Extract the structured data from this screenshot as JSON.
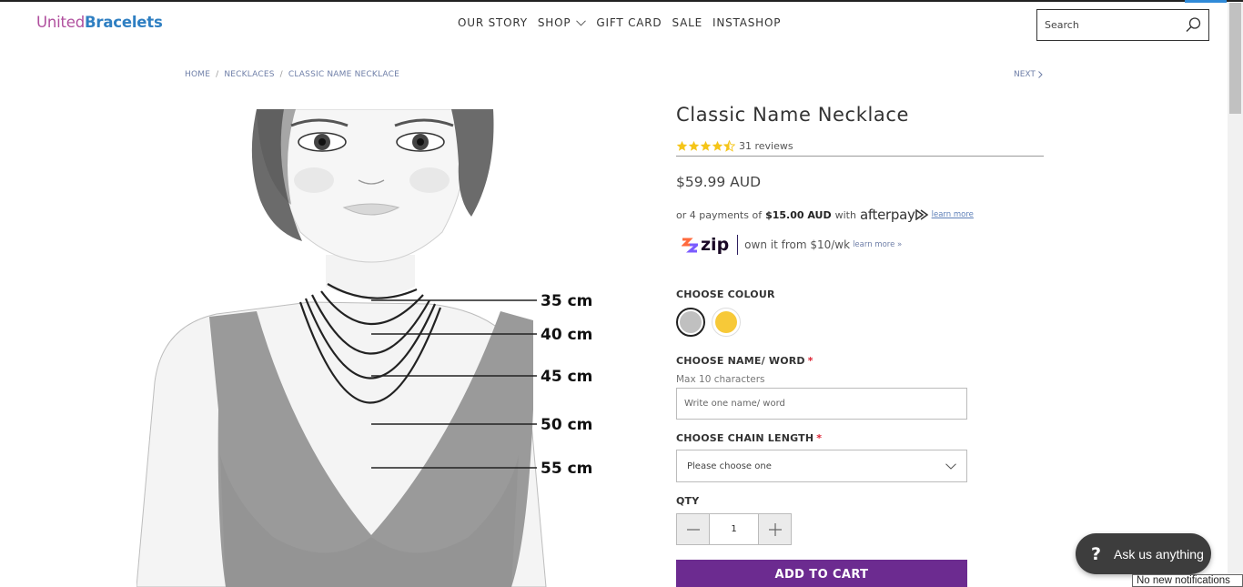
{
  "logo": {
    "part1": "United",
    "part2": "Bracelets"
  },
  "nav": {
    "items": [
      {
        "label": "OUR STORY"
      },
      {
        "label": "SHOP"
      },
      {
        "label": "GIFT CARD"
      },
      {
        "label": "SALE"
      },
      {
        "label": "INSTASHOP"
      }
    ]
  },
  "search": {
    "placeholder": "Search",
    "icon": "search-icon"
  },
  "breadcrumb": {
    "items": [
      "HOME",
      "NECKLACES",
      "CLASSIC NAME NECKLACE"
    ],
    "separator": "/",
    "next": "NEXT"
  },
  "product_image": {
    "chain_lengths": [
      "35 cm",
      "40 cm",
      "45 cm",
      "50 cm",
      "55 cm"
    ]
  },
  "product": {
    "title": "Classic Name Necklace",
    "rating": 4.5,
    "reviews": "31 reviews",
    "price": "$59.99 AUD"
  },
  "afterpay": {
    "prefix": "or 4 payments of",
    "amount": "$15.00 AUD",
    "with": "with",
    "brand": "afterpay",
    "learn_more": "learn more"
  },
  "zip": {
    "brand": "zip",
    "text": "own it from $10/wk",
    "learn_more": "learn more »"
  },
  "options": {
    "colour_label": "CHOOSE COLOUR",
    "colours": [
      {
        "name": "silver",
        "hex": "#c0c0c0",
        "selected": true
      },
      {
        "name": "gold",
        "hex": "#f7c938",
        "selected": false
      }
    ],
    "name_label": "CHOOSE NAME/ WORD",
    "required_mark": "*",
    "name_hint": "Max 10 characters",
    "name_placeholder": "Write one name/ word",
    "chain_label": "CHOOSE CHAIN LENGTH",
    "chain_selected": "Please choose one",
    "qty_label": "QTY",
    "qty_value": "1"
  },
  "cart": {
    "button": "ADD TO CART"
  },
  "chat": {
    "icon": "?",
    "label": "Ask us anything"
  },
  "notification": {
    "text": "No new notifications"
  },
  "colors": {
    "brand_purple": "#6c2b90",
    "logo_pink": "#b04f9e",
    "logo_blue": "#2f7fc2",
    "star": "#f5c518"
  }
}
